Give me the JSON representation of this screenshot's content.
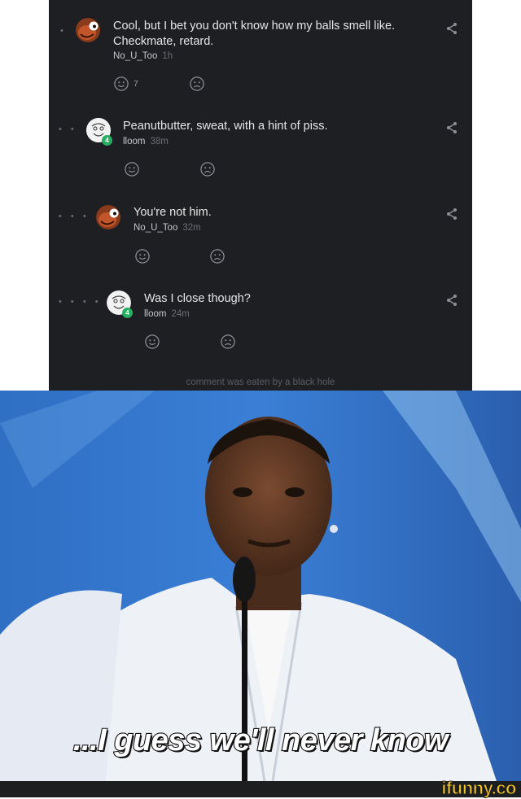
{
  "comments": [
    {
      "depth_dots": "•",
      "text": "Cool, but I bet you don't know how my balls smell like. Checkmate, retard.",
      "author": "No_U_Too",
      "time": "1h",
      "like_count": "7",
      "avatar_icon": "cartoon-face-icon"
    },
    {
      "depth_dots": "• •",
      "text": "Peanutbutter, sweat, with a hint of piss.",
      "author": "lloom",
      "time": "38m",
      "like_count": "",
      "avatar_icon": "sketch-face-icon",
      "badge": "4"
    },
    {
      "depth_dots": "• • •",
      "text": "You're not him.",
      "author": "No_U_Too",
      "time": "32m",
      "like_count": "",
      "avatar_icon": "cartoon-face-icon"
    },
    {
      "depth_dots": "• • • •",
      "text": "Was I close though?",
      "author": "lloom",
      "time": "24m",
      "like_count": "",
      "avatar_icon": "sketch-face-icon",
      "badge": "4"
    }
  ],
  "eaten_note": "comment was eaten by a black hole",
  "meme": {
    "caption": "...I guess we'll never know"
  },
  "watermark": "ifunny.co",
  "colors": {
    "thread_bg": "#1e1f23",
    "badge": "#27b062",
    "brand": "#f6c624",
    "meme_bg": "#2a5fae"
  }
}
